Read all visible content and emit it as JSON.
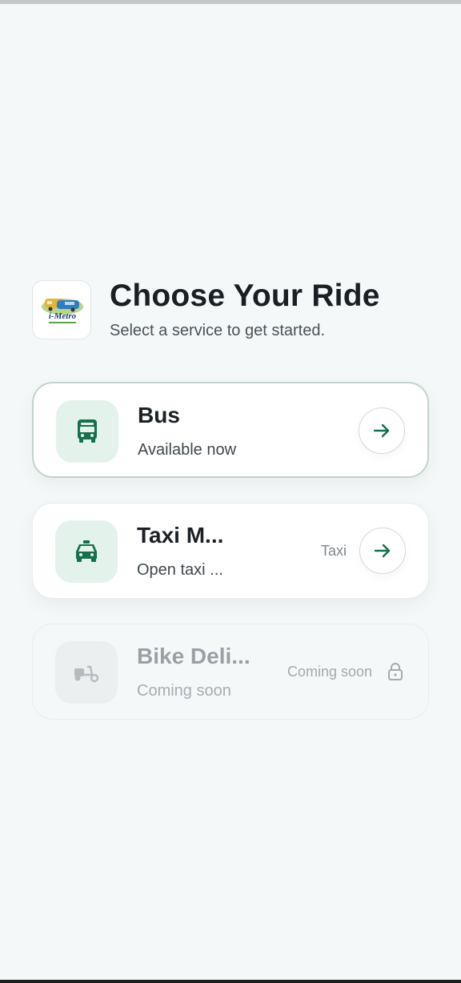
{
  "header": {
    "logo_text": "i-Metro",
    "title": "Choose Your Ride",
    "subtitle": "Select a service to get started."
  },
  "services": [
    {
      "title": "Bus",
      "subtitle": "Available now",
      "tag": "",
      "state": "selected",
      "icon": "bus-icon"
    },
    {
      "title": "Taxi M...",
      "subtitle": "Open taxi ...",
      "tag": "Taxi",
      "state": "available",
      "icon": "taxi-icon"
    },
    {
      "title": "Bike Deli...",
      "subtitle": "Coming soon",
      "tag": "Coming soon",
      "state": "disabled",
      "icon": "scooter-icon"
    }
  ],
  "colors": {
    "accent": "#16704b",
    "accent_tile": "#e3f3ec",
    "background": "#f4f8f8",
    "disabled_icon": "#b5bbbe"
  }
}
